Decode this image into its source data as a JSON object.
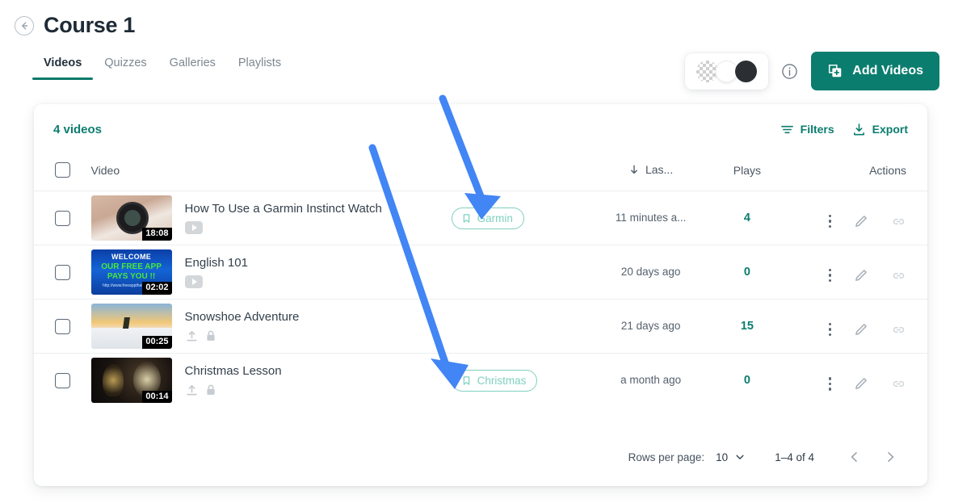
{
  "header": {
    "title": "Course 1",
    "back_icon": "back-arrow-circle-icon"
  },
  "tabs": [
    {
      "label": "Videos",
      "active": true
    },
    {
      "label": "Quizzes",
      "active": false
    },
    {
      "label": "Galleries",
      "active": false
    },
    {
      "label": "Playlists",
      "active": false
    }
  ],
  "toolbar": {
    "swatches": [
      {
        "name": "transparent",
        "color": "transparent"
      },
      {
        "name": "white",
        "color": "#ffffff"
      },
      {
        "name": "dark",
        "color": "#2b2f33"
      }
    ],
    "info_icon": "info-icon",
    "add_videos_label": "Add Videos",
    "add_videos_icon": "add-video-plus-icon",
    "accent_color": "#0b7d6e"
  },
  "card": {
    "count_label": "4 videos",
    "filters_label": "Filters",
    "filters_icon": "filter-icon",
    "export_label": "Export",
    "export_icon": "download-icon"
  },
  "table": {
    "columns": {
      "video": "Video",
      "last": "Las...",
      "plays": "Plays",
      "actions": "Actions",
      "sort_icon": "sort-descending-arrow-icon"
    },
    "rows": [
      {
        "title": "How To Use a Garmin Instinct Watch",
        "duration": "18:08",
        "source_icon": "youtube-icon",
        "tag": "Garmin",
        "last_activity": "11 minutes a...",
        "plays": "4"
      },
      {
        "title": "English 101",
        "duration": "02:02",
        "source_icon": "youtube-icon",
        "tag": "",
        "last_activity": "20 days ago",
        "plays": "0"
      },
      {
        "title": "Snowshoe Adventure",
        "duration": "00:25",
        "source_icon": "upload-lock-icons",
        "tag": "",
        "last_activity": "21 days ago",
        "plays": "15"
      },
      {
        "title": "Christmas Lesson",
        "duration": "00:14",
        "source_icon": "upload-lock-icons",
        "tag": "Christmas",
        "last_activity": "a month ago",
        "plays": "0"
      }
    ]
  },
  "pagination": {
    "rows_per_page_label": "Rows per page:",
    "rows_per_page_value": "10",
    "range_label": "1–4 of 4",
    "prev_icon": "chevron-left-icon",
    "next_icon": "chevron-right-icon"
  },
  "annotations": {
    "arrow_color": "#4285f4",
    "arrows": [
      {
        "name": "arrow-to-garmin-tag"
      },
      {
        "name": "arrow-to-christmas-tag"
      }
    ]
  }
}
